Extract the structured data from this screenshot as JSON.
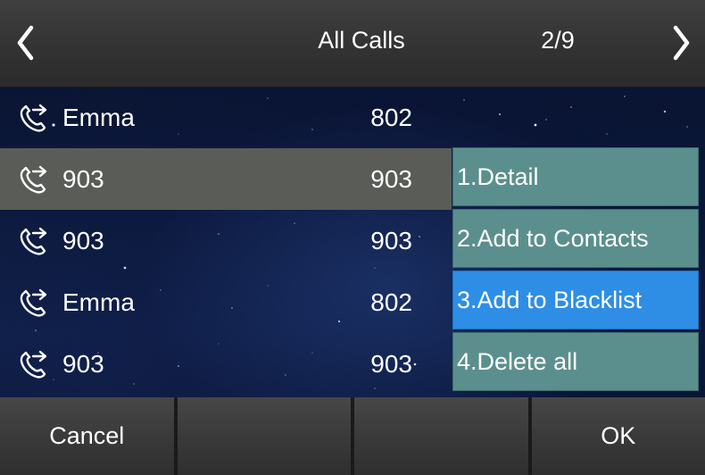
{
  "titlebar": {
    "title": "All Calls",
    "page_indicator": "2/9"
  },
  "calls": [
    {
      "name": "Emma",
      "number": "802",
      "icon": "outgoing-call-icon",
      "selected": false
    },
    {
      "name": "903",
      "number": "903",
      "icon": "outgoing-call-icon",
      "selected": true
    },
    {
      "name": "903",
      "number": "903",
      "icon": "outgoing-call-icon",
      "selected": false
    },
    {
      "name": "Emma",
      "number": "802",
      "icon": "outgoing-call-icon",
      "selected": false
    },
    {
      "name": "903",
      "number": "903",
      "icon": "outgoing-call-icon",
      "selected": false
    }
  ],
  "menu": {
    "items": [
      {
        "label": "1.Detail",
        "active": false
      },
      {
        "label": "2.Add to Contacts",
        "active": false
      },
      {
        "label": "3.Add to Blacklist",
        "active": true
      },
      {
        "label": "4.Delete all",
        "active": false
      }
    ]
  },
  "softkeys": {
    "key1": "Cancel",
    "key2": "",
    "key3": "",
    "key4": "OK"
  },
  "colors": {
    "menu_item": "#5b8f8d",
    "menu_item_active": "#2e8ee6",
    "selected_row": "#5a5c58",
    "titlebar": "#333333"
  }
}
